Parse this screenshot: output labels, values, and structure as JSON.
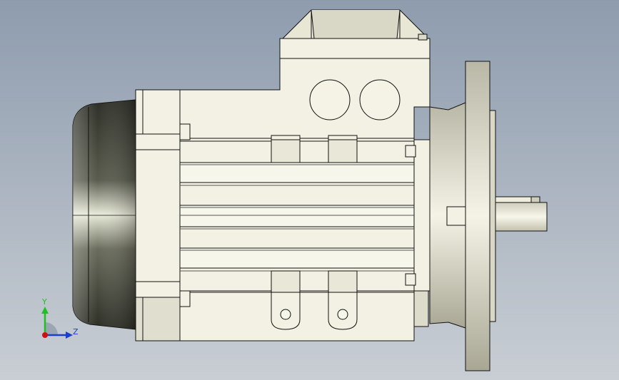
{
  "viewport": {
    "background_top": "#8e9cae",
    "background_bottom": "#c9ced4"
  },
  "model": {
    "body_color": "#f2f1e4",
    "edge_color": "#111111",
    "shade_color": "#bdbba8",
    "fan_cover_dark": "#3f4136",
    "fan_cover_light": "#e9ebd9"
  },
  "triad": {
    "y_label": "Y",
    "z_label": "Z",
    "y_color": "#20c020",
    "z_color": "#1a3fd0",
    "origin_color": "#d01010"
  }
}
